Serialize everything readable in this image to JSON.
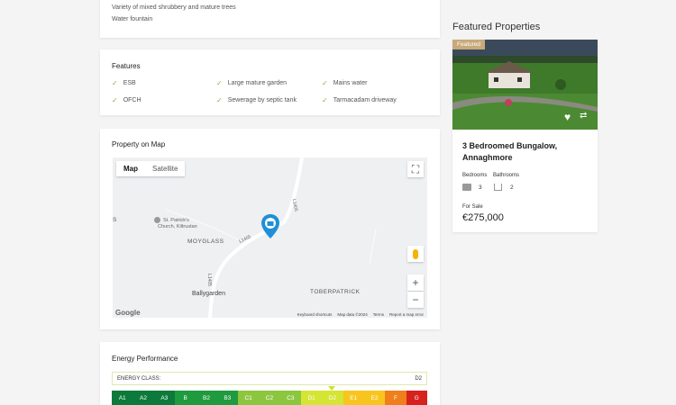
{
  "garden": {
    "line1": "Variety of mixed shrubbery and mature trees",
    "line2": "Water fountain"
  },
  "features": {
    "title": "Features",
    "items": [
      "ESB",
      "Large mature garden",
      "Mains water",
      "OFCH",
      "Sewerage by septic tank",
      "Tarmacadam driveway"
    ]
  },
  "map": {
    "title": "Property on Map",
    "map_label": "Map",
    "satellite_label": "Satellite",
    "places": {
      "church1": "St. Patrick's",
      "church2": "Church, Kiltrustan",
      "moyglass": "MOYGLASS",
      "ballygarden": "Ballygarden",
      "toberpatrick": "TOBERPATRICK",
      "edge": "S"
    },
    "roads": {
      "r1": "L1405",
      "r2": "L1405",
      "r3": "L1405"
    },
    "google": "Google",
    "footer": {
      "shortcuts": "Keyboard shortcuts",
      "mapdata": "Map data ©2024",
      "terms": "Terms",
      "report": "Report a map error"
    },
    "zoom_in": "+",
    "zoom_out": "−"
  },
  "energy": {
    "title": "Energy Performance",
    "class_label": "ENERGY CLASS:",
    "class_value": "D2",
    "bands": [
      {
        "label": "A1",
        "color": "#0b7a3a"
      },
      {
        "label": "A2",
        "color": "#0b7a3a"
      },
      {
        "label": "A3",
        "color": "#0b7a3a"
      },
      {
        "label": "B",
        "color": "#1f9a3e"
      },
      {
        "label": "B2",
        "color": "#1f9a3e"
      },
      {
        "label": "B3",
        "color": "#1f9a3e"
      },
      {
        "label": "C1",
        "color": "#8cc63f"
      },
      {
        "label": "C2",
        "color": "#8cc63f"
      },
      {
        "label": "C3",
        "color": "#8cc63f"
      },
      {
        "label": "D1",
        "color": "#d4e534"
      },
      {
        "label": "D2",
        "color": "#d4e534"
      },
      {
        "label": "E1",
        "color": "#f7c51e"
      },
      {
        "label": "E2",
        "color": "#f7c51e"
      },
      {
        "label": "F",
        "color": "#ee7f1b"
      },
      {
        "label": "G",
        "color": "#d6211c"
      }
    ]
  },
  "featured": {
    "heading": "Featured Properties",
    "tag": "Featured",
    "title": "3 Bedroomed Bungalow, Annaghmore",
    "bedrooms_label": "Bedrooms",
    "bathrooms_label": "Bathrooms",
    "bedrooms": "3",
    "bathrooms": "2",
    "status": "For Sale",
    "price": "€275,000"
  }
}
